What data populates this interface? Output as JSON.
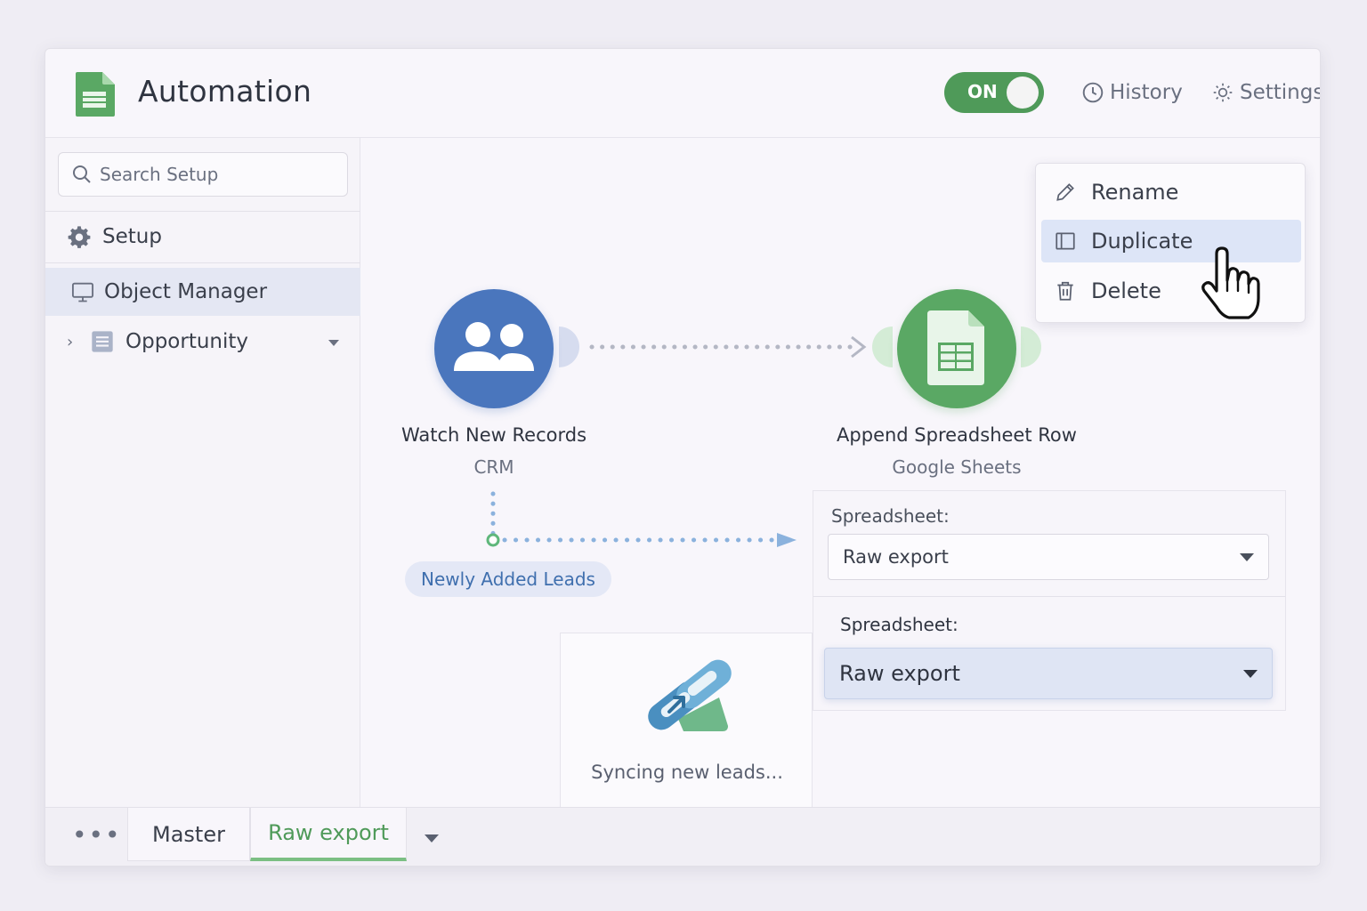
{
  "header": {
    "title": "Automation",
    "toggle_label": "ON",
    "history_label": "History",
    "settings_label": "Settings"
  },
  "sidebar": {
    "search_placeholder": "Search Setup",
    "items": [
      {
        "label": "Setup",
        "icon": "gear-icon"
      },
      {
        "label": "Object Manager",
        "icon": "monitor-icon",
        "selected": true
      },
      {
        "label": "Opportunity",
        "icon": "object-icon"
      }
    ]
  },
  "flow": {
    "trigger": {
      "title": "Watch New Records",
      "subtitle": "CRM",
      "icon": "users-icon"
    },
    "action": {
      "title": "Append Spreadsheet Row",
      "subtitle": "Google Sheets",
      "icon": "sheets-icon"
    },
    "filter_label": "Newly Added Leads",
    "sync_status": "Syncing new leads..."
  },
  "config": {
    "field1_label": "Spreadsheet:",
    "field1_value": "Raw export",
    "field2_label": "Spreadsheet:",
    "field2_value": "Raw export"
  },
  "context_menu": {
    "items": [
      {
        "label": "Rename",
        "icon": "pencil-icon"
      },
      {
        "label": "Duplicate",
        "icon": "copy-icon",
        "highlighted": true
      },
      {
        "label": "Delete",
        "icon": "trash-icon"
      }
    ]
  },
  "tabs": {
    "items": [
      {
        "label": "Master"
      },
      {
        "label": "Raw export",
        "active": true
      }
    ]
  },
  "colors": {
    "accent_green": "#4f9a59",
    "trigger_blue": "#4a76bd",
    "link_blue": "#3f6fae"
  }
}
